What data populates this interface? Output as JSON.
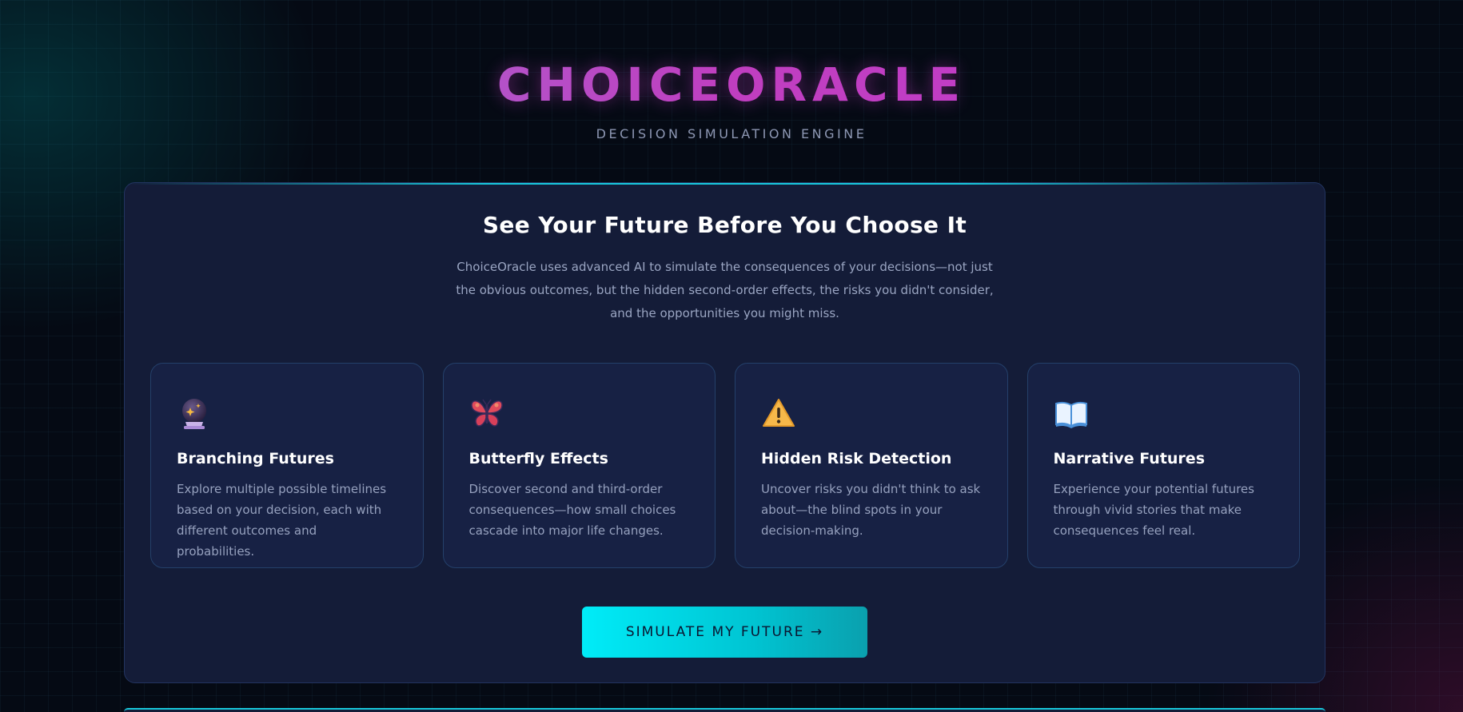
{
  "brand": {
    "logo_text": "CHOICEORACLE",
    "tagline": "DECISION SIMULATION ENGINE"
  },
  "hero": {
    "title": "See Your Future Before You Choose It",
    "description": "ChoiceOracle uses advanced AI to simulate the consequences of your decisions—not just the obvious outcomes, but the hidden second-order effects, the risks you didn't consider, and the opportunities you might miss."
  },
  "features": [
    {
      "icon": "crystal-ball-icon",
      "title": "Branching Futures",
      "description": "Explore multiple possible timelines based on your decision, each with different outcomes and probabilities."
    },
    {
      "icon": "butterfly-icon",
      "title": "Butterfly Effects",
      "description": "Discover second and third-order consequences—how small choices cascade into major life changes."
    },
    {
      "icon": "warning-icon",
      "title": "Hidden Risk Detection",
      "description": "Uncover risks you didn't think to ask about—the blind spots in your decision-making."
    },
    {
      "icon": "open-book-icon",
      "title": "Narrative Futures",
      "description": "Experience your potential futures through vivid stories that make consequences feel real."
    }
  ],
  "cta": {
    "label": "SIMULATE MY FUTURE →"
  },
  "colors": {
    "accent_cyan": "#00e5f2",
    "brand_magenta": "#c03ec0",
    "panel_bg": "#141c38",
    "page_bg": "#050a14"
  }
}
